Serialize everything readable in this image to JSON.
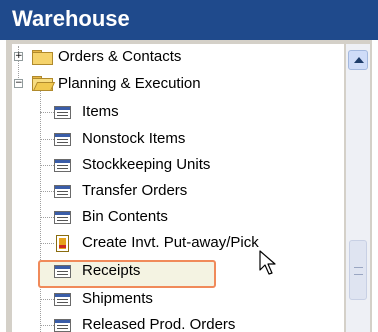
{
  "header": {
    "title": "Warehouse"
  },
  "tree": {
    "items": [
      {
        "label": "Orders & Contacts",
        "icon": "folder-icon",
        "expander": "+"
      },
      {
        "label": "Planning & Execution",
        "icon": "folder-open-icon",
        "expander": "−"
      },
      {
        "label": "Items",
        "icon": "list-icon"
      },
      {
        "label": "Nonstock Items",
        "icon": "list-icon"
      },
      {
        "label": "Stockkeeping Units",
        "icon": "list-icon"
      },
      {
        "label": "Transfer Orders",
        "icon": "list-icon"
      },
      {
        "label": "Bin Contents",
        "icon": "list-icon"
      },
      {
        "label": "Create Invt. Put-away/Pick",
        "icon": "report-icon"
      },
      {
        "label": "Receipts",
        "icon": "list-icon",
        "highlighted": true
      },
      {
        "label": "Shipments",
        "icon": "list-icon"
      },
      {
        "label": "Released Prod. Orders",
        "icon": "list-icon"
      }
    ]
  },
  "colors": {
    "header_bg": "#1f4a8c",
    "highlight_border": "#f08a5a"
  }
}
